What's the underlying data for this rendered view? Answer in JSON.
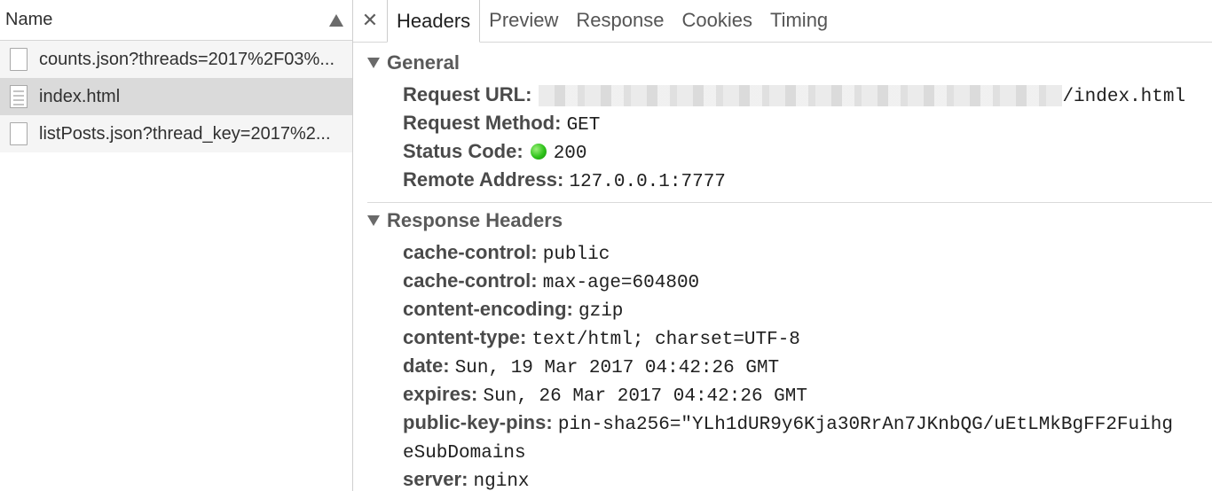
{
  "left_panel": {
    "header": {
      "label": "Name"
    },
    "requests": [
      {
        "label": "counts.json?threads=2017%2F03%..."
      },
      {
        "label": "index.html"
      },
      {
        "label": "listPosts.json?thread_key=2017%2..."
      }
    ]
  },
  "tabs": {
    "close": "✕",
    "items": [
      "Headers",
      "Preview",
      "Response",
      "Cookies",
      "Timing"
    ]
  },
  "general": {
    "title": "General",
    "request_url": {
      "key": "Request URL:",
      "value": "/index.html"
    },
    "request_method": {
      "key": "Request Method:",
      "value": "GET"
    },
    "status_code": {
      "key": "Status Code:",
      "value": "200"
    },
    "remote_address": {
      "key": "Remote Address:",
      "value": "127.0.0.1:7777"
    }
  },
  "response_headers": {
    "title": "Response Headers",
    "items": [
      {
        "key": "cache-control:",
        "value": "public"
      },
      {
        "key": "cache-control:",
        "value": "max-age=604800"
      },
      {
        "key": "content-encoding:",
        "value": "gzip"
      },
      {
        "key": "content-type:",
        "value": "text/html; charset=UTF-8"
      },
      {
        "key": "date:",
        "value": "Sun, 19 Mar 2017 04:42:26 GMT"
      },
      {
        "key": "expires:",
        "value": "Sun, 26 Mar 2017 04:42:26 GMT"
      },
      {
        "key": "public-key-pins:",
        "value": "pin-sha256=\"YLh1dUR9y6Kja30RrAn7JKnbQG/uEtLMkBgFF2Fuihg"
      },
      {
        "key": "",
        "value": "eSubDomains"
      },
      {
        "key": "server:",
        "value": "nginx"
      }
    ]
  },
  "colors": {
    "status_ok": "#2ec21a",
    "selected_row": "#dadada"
  }
}
